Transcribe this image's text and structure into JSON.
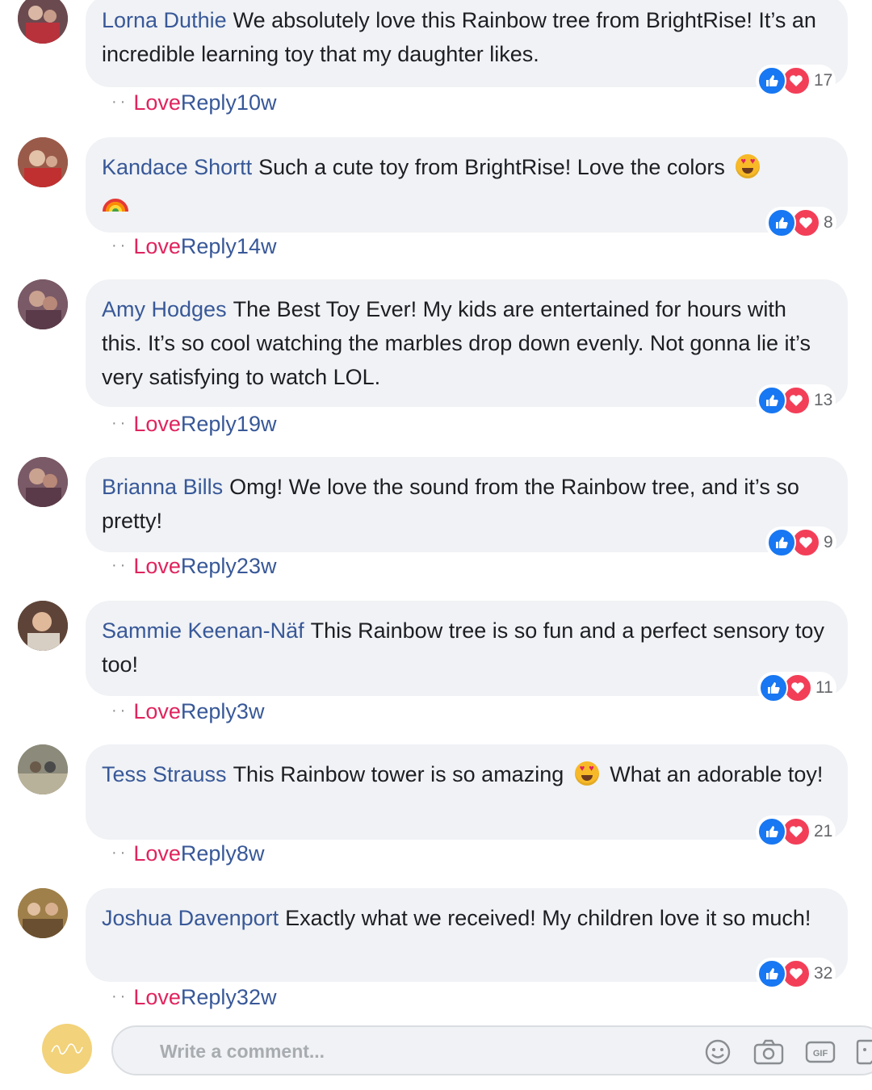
{
  "comments": [
    {
      "author": "Lorna Duthie",
      "text": "We absolutely love this Rainbow tree from BrightRise! It’s an incredible learning toy that my daughter likes.",
      "reaction_count": "17",
      "love_label": "Love",
      "reply_label": "Reply",
      "time": "10w",
      "avatar_color": "#6b4a4f"
    },
    {
      "author": "Kandace Shortt",
      "text": "Such a cute toy from BrightRise! Love the colors",
      "emoji_after": "heart-eyes-emoji",
      "emoji_line2": "rainbow-emoji",
      "reaction_count": "8",
      "love_label": "Love",
      "reply_label": "Reply",
      "time": "14w",
      "avatar_color": "#9a5a4a"
    },
    {
      "author": "Amy Hodges",
      "text": "The Best Toy Ever! My kids are entertained for hours with this. It’s so cool watching the marbles drop down evenly. Not gonna lie it’s very satisfying to watch LOL.",
      "reaction_count": "13",
      "love_label": "Love",
      "reply_label": "Reply",
      "time": "19w",
      "avatar_color": "#7a5a66"
    },
    {
      "author": "Brianna Bills",
      "text": "Omg! We love the sound from the Rainbow tree, and it’s so pretty!",
      "reaction_count": "9",
      "love_label": "Love",
      "reply_label": "Reply",
      "time": "23w",
      "avatar_color": "#7a5a66"
    },
    {
      "author": "Sammie Keenan-Näf",
      "text": "This Rainbow tree is so fun and a perfect sensory toy too!",
      "reaction_count": "11",
      "love_label": "Love",
      "reply_label": "Reply",
      "time": "3w",
      "avatar_color": "#5e4438"
    },
    {
      "author": "Tess Strauss",
      "text_before_emoji": "This Rainbow tower is so amazing",
      "emoji_inline": "heart-eyes-emoji",
      "text_after_emoji": "What an adorable toy!",
      "reaction_count": "21",
      "love_label": "Love",
      "reply_label": "Reply",
      "time": "8w",
      "avatar_color": "#8c8a7a"
    },
    {
      "author": "Joshua Davenport",
      "text": "Exactly what we received! My children love it so much!",
      "reaction_count": "32",
      "love_label": "Love",
      "reply_label": "Reply",
      "time": "32w",
      "avatar_color": "#a0804a"
    }
  ],
  "composer": {
    "placeholder": "Write a comment...",
    "icons": [
      "emoji-icon",
      "camera-icon",
      "gif-icon",
      "sticker-icon"
    ]
  },
  "colors": {
    "author_link": "#385898",
    "love": "#e0245e",
    "like_blue": "#1877f2",
    "love_red": "#f33e58",
    "bubble": "#f0f2f5"
  }
}
